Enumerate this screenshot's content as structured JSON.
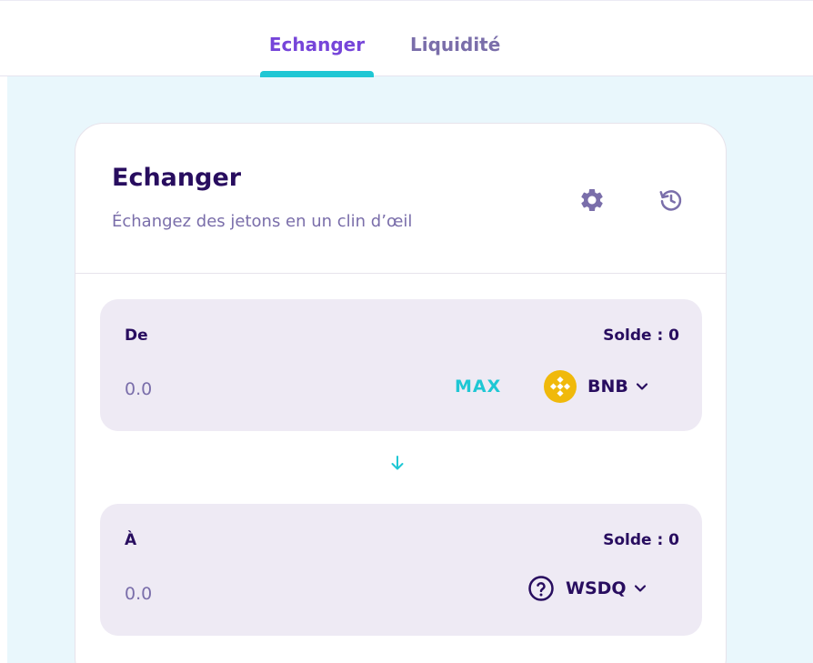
{
  "nav": {
    "tabs": [
      {
        "label": "Echanger",
        "active": true
      },
      {
        "label": "Liquidité",
        "active": false
      }
    ]
  },
  "card": {
    "title": "Echanger",
    "subtitle": "Échangez des jetons en un clin d’œil",
    "icons": [
      "gear-icon",
      "history-icon"
    ]
  },
  "from": {
    "label": "De",
    "balance": "Solde : 0",
    "amount_placeholder": "0.0",
    "max_label": "MAX",
    "token": "BNB",
    "token_icon": "bnb-logo-icon"
  },
  "to": {
    "label": "À",
    "balance": "Solde : 0",
    "amount_placeholder": "0.0",
    "token": "WSDQ",
    "token_icon": "question-circle-icon"
  },
  "colors": {
    "primary": "#7645d9",
    "accent": "#1fc7d4",
    "text": "#280d5f",
    "subtle": "#7a6eaa",
    "panel": "#eeeaf4",
    "page_bg": "#e9f7fc",
    "bnb": "#f0b90b"
  }
}
